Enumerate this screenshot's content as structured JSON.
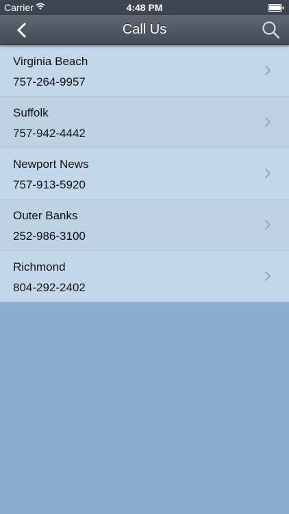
{
  "status_bar": {
    "carrier": "Carrier",
    "time": "4:48 PM"
  },
  "nav": {
    "title": "Call Us",
    "back_icon": "chevron-left-icon",
    "search_icon": "search-icon"
  },
  "locations": [
    {
      "city": "Virginia Beach",
      "phone": "757-264-9957"
    },
    {
      "city": "Suffolk",
      "phone": "757-942-4442"
    },
    {
      "city": "Newport News",
      "phone": "757-913-5920"
    },
    {
      "city": "Outer Banks",
      "phone": "252-986-3100"
    },
    {
      "city": "Richmond",
      "phone": "804-292-2402"
    }
  ],
  "colors": {
    "nav_bar": "#4f5862",
    "row_light": "#c3d7ea",
    "row_dark": "#bed2e4",
    "background": "#8aadd0"
  }
}
